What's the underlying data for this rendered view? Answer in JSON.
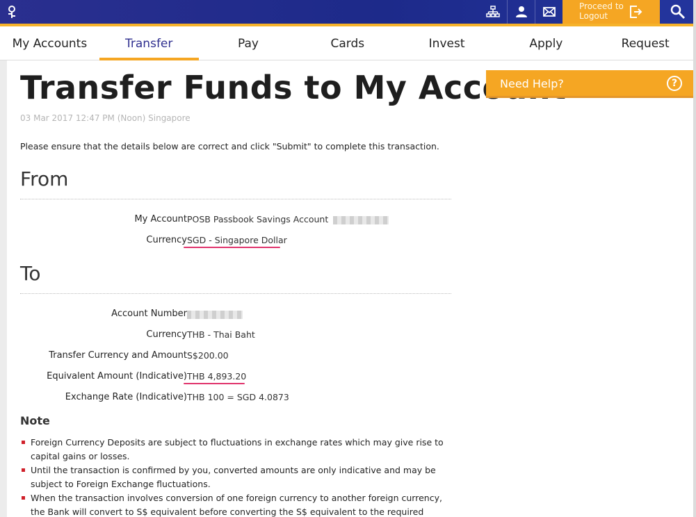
{
  "header": {
    "logout_label": "Proceed to Logout"
  },
  "nav": {
    "items": [
      {
        "label": "My Accounts"
      },
      {
        "label": "Transfer"
      },
      {
        "label": "Pay"
      },
      {
        "label": "Cards"
      },
      {
        "label": "Invest"
      },
      {
        "label": "Apply"
      },
      {
        "label": "Request"
      }
    ],
    "active_index": 1
  },
  "page": {
    "title": "Transfer Funds to My Account",
    "timestamp": "03 Mar 2017 12:47 PM (Noon) Singapore",
    "instructions": "Please ensure that the details below are correct and click \"Submit\" to complete this transaction."
  },
  "from": {
    "heading": "From",
    "account_label": "My Account",
    "account_value": "POSB Passbook Savings Account",
    "currency_label": "Currency",
    "currency_value": "SGD - Singapore Dollar"
  },
  "to": {
    "heading": "To",
    "account_number_label": "Account Number",
    "currency_label": "Currency",
    "currency_value": "THB - Thai Baht",
    "transfer_label": "Transfer Currency and Amount",
    "transfer_value": "S$200.00",
    "equivalent_label": "Equivalent Amount (Indicative)",
    "equivalent_value": "THB 4,893.20",
    "rate_label": "Exchange Rate (Indicative)",
    "rate_value": "THB 100 = SGD 4.0873"
  },
  "note": {
    "heading": "Note",
    "items": [
      "Foreign Currency Deposits are subject to fluctuations in exchange rates which may give rise to capital gains or losses.",
      "Until the transaction is confirmed by you, converted amounts are only indicative and may be subject to Foreign Exchange fluctuations.",
      "When the transaction involves conversion of one foreign currency to another foreign currency, the Bank will convert to S$ equivalent before converting the S$ equivalent to the required foreign currency."
    ]
  },
  "help": {
    "label": "Need Help?",
    "icon_glyph": "?"
  },
  "colors": {
    "header_blue": "#1d2a8a",
    "accent_orange": "#f5a623",
    "highlight_pink": "#e0336c",
    "bullet_red": "#d0202a"
  }
}
